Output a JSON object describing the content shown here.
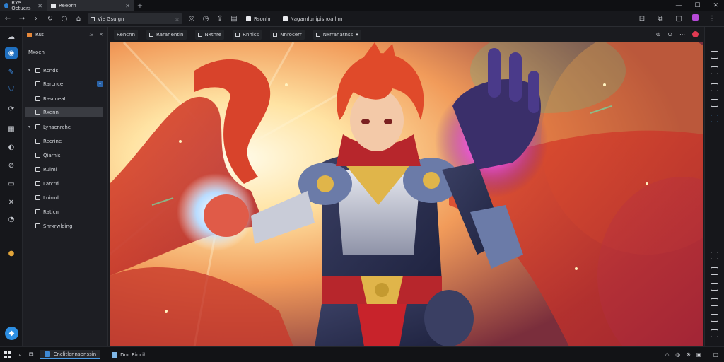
{
  "window": {
    "tabs": [
      {
        "label": "Rxe Octuers"
      },
      {
        "label": "Reeorn"
      }
    ],
    "controls": {
      "minimize": "—",
      "maximize": "☐",
      "close": "✕"
    }
  },
  "toolbar": {
    "address_text": "Vie Gsuign",
    "bookmarks": [
      {
        "label": "Rsonhrl"
      },
      {
        "label": "Nagamlunipisnoa lim"
      }
    ]
  },
  "explorer": {
    "header": "Rut",
    "section": "Mxoen",
    "items": [
      {
        "label": "Rcnds",
        "twisty": "▾"
      },
      {
        "label": "Rarcnce"
      },
      {
        "label": "Rascneat"
      },
      {
        "label": "Rxenn"
      },
      {
        "label": "Lynscnrche",
        "twisty": "▾"
      },
      {
        "label": "Recrine"
      },
      {
        "label": "Qiarnis"
      },
      {
        "label": "Ruiml"
      },
      {
        "label": "Larcrd"
      },
      {
        "label": "Lnirnd"
      },
      {
        "label": "Raticn"
      },
      {
        "label": "Snrxrwlding"
      }
    ]
  },
  "editor_tabs": [
    {
      "label": "Rencnn"
    },
    {
      "label": "Raranentin"
    },
    {
      "label": "Nxtnre"
    },
    {
      "label": "Rnnlcs"
    },
    {
      "label": "Nnrocerr"
    },
    {
      "label": "Nxrranatnss"
    }
  ],
  "taskbar": {
    "tasks": [
      {
        "label": "Cnclitlcnnsbnssin"
      },
      {
        "label": "Dnc Rincih"
      }
    ],
    "clock_time": "",
    "clock_date": ""
  },
  "colors": {
    "accent": "#2d8fe3",
    "selected": "#3a3c42",
    "background": "#1b1b1f"
  }
}
